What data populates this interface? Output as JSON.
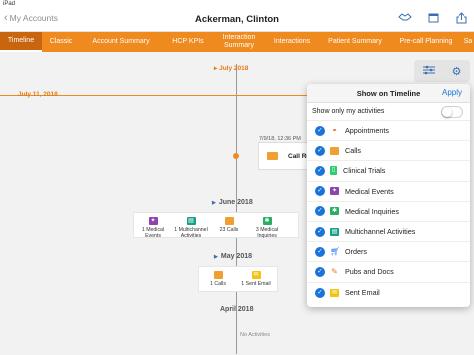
{
  "status": {
    "carrier": "iPad"
  },
  "nav": {
    "back_label": "My Accounts",
    "title": "Ackerman, Clinton"
  },
  "tabs": [
    {
      "label": "Timeline",
      "active": true
    },
    {
      "label": "Classic"
    },
    {
      "label": "Account Summary"
    },
    {
      "label": "HCP KPIs"
    },
    {
      "label": "Interaction Summary"
    },
    {
      "label": "Interactions"
    },
    {
      "label": "Patient Summary"
    },
    {
      "label": "Pre-call Planning"
    },
    {
      "label": "Sa"
    }
  ],
  "timeline": {
    "month_marker": "July 2018",
    "today_label": "July 11, 2018",
    "call_card": {
      "time": "7/9/18, 12:36 PM",
      "label": "Call Re"
    },
    "june": {
      "label": "June 2018",
      "items": [
        {
          "icon": "medical-events-icon",
          "label": "1 Medical Events",
          "color": "#8e44ad"
        },
        {
          "icon": "multichannel-icon",
          "label": "1 Multichannel Activities",
          "color": "#16a085"
        },
        {
          "icon": "calls-icon",
          "label": "23 Calls",
          "color": "#f0a030"
        },
        {
          "icon": "medical-inquiries-icon",
          "label": "3 Medical Inquiries",
          "color": "#27ae60"
        }
      ]
    },
    "may": {
      "label": "May 2018",
      "items": [
        {
          "icon": "calls-icon",
          "label": "1 Calls",
          "color": "#f0a030"
        },
        {
          "icon": "sent-email-icon",
          "label": "1 Sent Email",
          "color": "#f1c40f"
        }
      ]
    },
    "april": {
      "label": "April 2018",
      "no_activities": "No Activities"
    }
  },
  "popover": {
    "title": "Show on Timeline",
    "apply": "Apply",
    "toggle_label": "Show only my activities",
    "toggle_on": false,
    "options": [
      {
        "label": "Appointments",
        "icon": "appointments-icon",
        "color": "#e8672a",
        "checked": true
      },
      {
        "label": "Calls",
        "icon": "calls-icon",
        "color": "#f0a030",
        "checked": true
      },
      {
        "label": "Clinical Trials",
        "icon": "clinical-trials-icon",
        "color": "#2ecc71",
        "checked": true
      },
      {
        "label": "Medical Events",
        "icon": "medical-events-icon",
        "color": "#8e44ad",
        "checked": true
      },
      {
        "label": "Medical Inquiries",
        "icon": "medical-inquiries-icon",
        "color": "#27ae60",
        "checked": true
      },
      {
        "label": "Multichannel Activities",
        "icon": "multichannel-icon",
        "color": "#16a085",
        "checked": true
      },
      {
        "label": "Orders",
        "icon": "orders-icon",
        "color": "#2f80ed",
        "checked": true
      },
      {
        "label": "Pubs and Docs",
        "icon": "pubs-docs-icon",
        "color": "#e67e22",
        "checked": true
      },
      {
        "label": "Sent Email",
        "icon": "sent-email-icon",
        "color": "#f1c40f",
        "checked": true
      }
    ]
  }
}
